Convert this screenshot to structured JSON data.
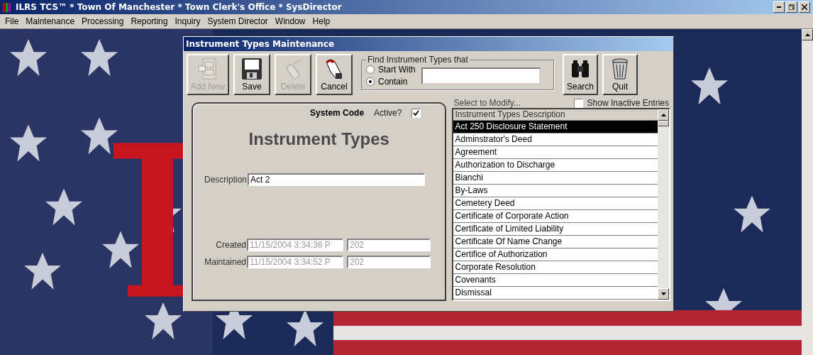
{
  "app": {
    "title": "ILRS TCS™ * Town Of Manchester * Town Clerk's Office * SysDirector",
    "menu": [
      "File",
      "Maintenance",
      "Processing",
      "Reporting",
      "Inquiry",
      "System Director",
      "Window",
      "Help"
    ]
  },
  "dialog": {
    "title": "Instrument Types Maintenance",
    "left_buttons": [
      {
        "label": "Add New",
        "kind": "add",
        "disabled": true
      },
      {
        "label": "Save",
        "kind": "save",
        "disabled": false
      },
      {
        "label": "Delete",
        "kind": "delete",
        "disabled": true
      },
      {
        "label": "Cancel",
        "kind": "cancel",
        "disabled": false
      }
    ],
    "find": {
      "legend": "Find Instrument Types that",
      "options": [
        {
          "label": "Start With",
          "selected": false
        },
        {
          "label": "Contain",
          "selected": true
        }
      ]
    },
    "right_buttons": [
      {
        "label": "Search",
        "kind": "search",
        "disabled": false
      },
      {
        "label": "Quit",
        "kind": "quit",
        "disabled": false
      }
    ],
    "form": {
      "system_code_label": "System Code",
      "active_label": "Active?",
      "active_checked": true,
      "heading": "Instrument Types",
      "description": {
        "label": "Description",
        "value": "Act 2"
      },
      "audit": [
        {
          "label": "Created",
          "date": "11/15/2004 3:34:36 P",
          "user": "202"
        },
        {
          "label": "Maintained",
          "date": "11/15/2004 3:34:52 P",
          "user": "202"
        }
      ]
    },
    "list": {
      "caption": "Select to Modify...",
      "show_inactive": {
        "label": "Show Inactive Entries",
        "checked": false
      },
      "column": "Instrument Types Description",
      "rows": [
        {
          "text": "Act 250 Disclosure Statement",
          "selected": true
        },
        {
          "text": "Adminstrator's Deed",
          "selected": false
        },
        {
          "text": "Agreement",
          "selected": false
        },
        {
          "text": "Authorization to Discharge",
          "selected": false
        },
        {
          "text": "Bianchi",
          "selected": false
        },
        {
          "text": "By-Laws",
          "selected": false
        },
        {
          "text": "Cemetery Deed",
          "selected": false
        },
        {
          "text": "Certificate of Corporate Action",
          "selected": false
        },
        {
          "text": "Certificate of Limited Liability",
          "selected": false
        },
        {
          "text": "Certificate Of Name Change",
          "selected": false
        },
        {
          "text": "Certifice of Authorization",
          "selected": false
        },
        {
          "text": "Corporate Resolution",
          "selected": false
        },
        {
          "text": "Covenants",
          "selected": false
        },
        {
          "text": "Dismissal",
          "selected": false
        }
      ]
    }
  }
}
